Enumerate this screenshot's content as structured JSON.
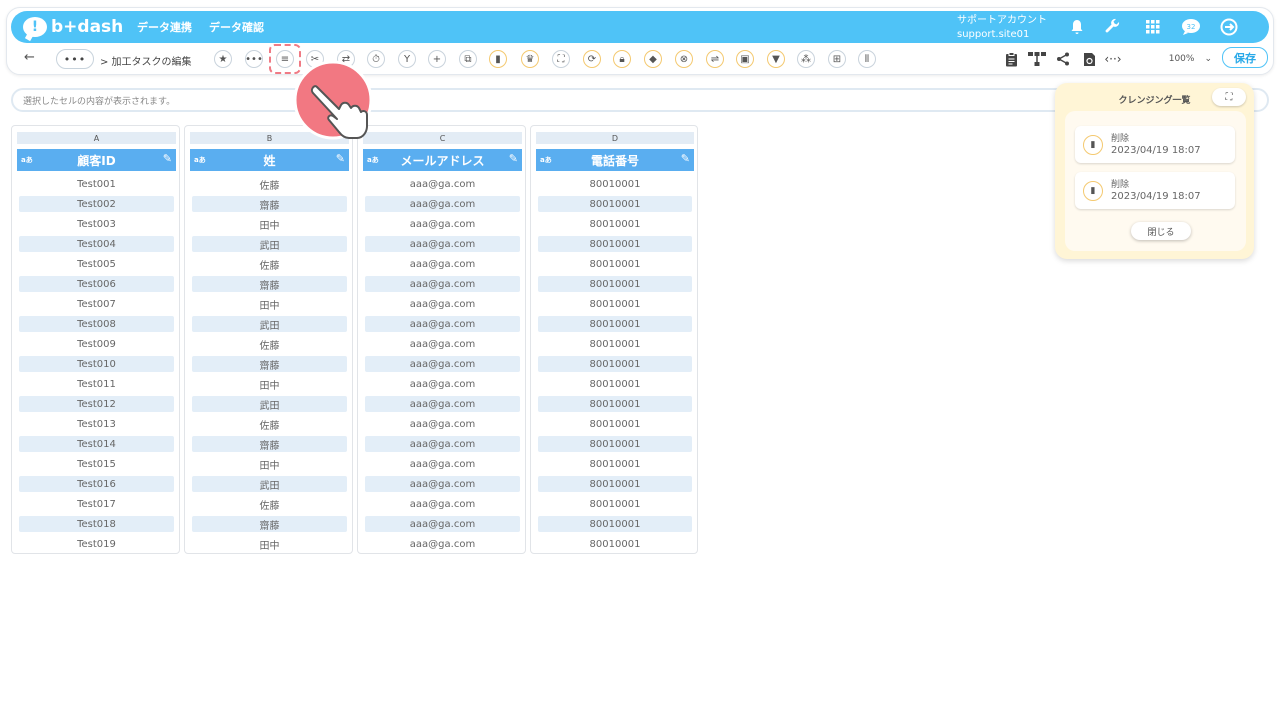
{
  "app": {
    "logo_text": "b+dash",
    "nav": [
      "データ連携",
      "データ確認"
    ],
    "account_name": "サポートアカウント",
    "account_site": "support.site01"
  },
  "toolbar": {
    "back_icon": "arrow-left-icon",
    "more_label": "•••",
    "breadcrumb": "> 加工タスクの編集",
    "zoom": "100%",
    "save_label": "保存",
    "tools": [
      "star-icon",
      "more-icon",
      "text-icon",
      "scissors-icon",
      "merge-icon",
      "timer-icon",
      "split-icon",
      "plus-icon",
      "copy-icon",
      "trash-icon",
      "crown-icon",
      "expand-icon",
      "repeat-icon",
      "lock-icon",
      "box-icon",
      "close-circle-icon",
      "shuffle-icon",
      "square-icon",
      "filter-icon",
      "group-icon",
      "grid-icon",
      "columns-icon"
    ]
  },
  "formula_bar": {
    "placeholder": "選択したセルの内容が表示されます。"
  },
  "columns": [
    {
      "letter": "A",
      "type_badge": "aあ",
      "header": "顧客ID",
      "cells": [
        "Test001",
        "Test002",
        "Test003",
        "Test004",
        "Test005",
        "Test006",
        "Test007",
        "Test008",
        "Test009",
        "Test010",
        "Test011",
        "Test012",
        "Test013",
        "Test014",
        "Test015",
        "Test016",
        "Test017",
        "Test018",
        "Test019"
      ]
    },
    {
      "letter": "B",
      "type_badge": "aあ",
      "header": "姓",
      "cells": [
        "佐藤",
        "齋藤",
        "田中",
        "武田",
        "佐藤",
        "齋藤",
        "田中",
        "武田",
        "佐藤",
        "齋藤",
        "田中",
        "武田",
        "佐藤",
        "齋藤",
        "田中",
        "武田",
        "佐藤",
        "齋藤",
        "田中"
      ]
    },
    {
      "letter": "C",
      "type_badge": "aあ",
      "header": "メールアドレス",
      "cells": [
        "aaa@ga.com",
        "aaa@ga.com",
        "aaa@ga.com",
        "aaa@ga.com",
        "aaa@ga.com",
        "aaa@ga.com",
        "aaa@ga.com",
        "aaa@ga.com",
        "aaa@ga.com",
        "aaa@ga.com",
        "aaa@ga.com",
        "aaa@ga.com",
        "aaa@ga.com",
        "aaa@ga.com",
        "aaa@ga.com",
        "aaa@ga.com",
        "aaa@ga.com",
        "aaa@ga.com",
        "aaa@ga.com"
      ]
    },
    {
      "letter": "D",
      "type_badge": "aあ",
      "header": "電話番号",
      "cells": [
        "80010001",
        "80010001",
        "80010001",
        "80010001",
        "80010001",
        "80010001",
        "80010001",
        "80010001",
        "80010001",
        "80010001",
        "80010001",
        "80010001",
        "80010001",
        "80010001",
        "80010001",
        "80010001",
        "80010001",
        "80010001",
        "80010001"
      ]
    }
  ],
  "cleansing_panel": {
    "title": "クレンジング一覧",
    "items": [
      {
        "label": "削除",
        "time": "2023/04/19 18:07"
      },
      {
        "label": "削除",
        "time": "2023/04/19 18:07"
      }
    ],
    "close_label": "閉じる"
  },
  "colors": {
    "brand": "#4fc3f7",
    "header_blue": "#5aaef0",
    "alt_row": "#e3eef8",
    "panel_bg": "#fff5d6",
    "highlight": "#f07a84"
  }
}
